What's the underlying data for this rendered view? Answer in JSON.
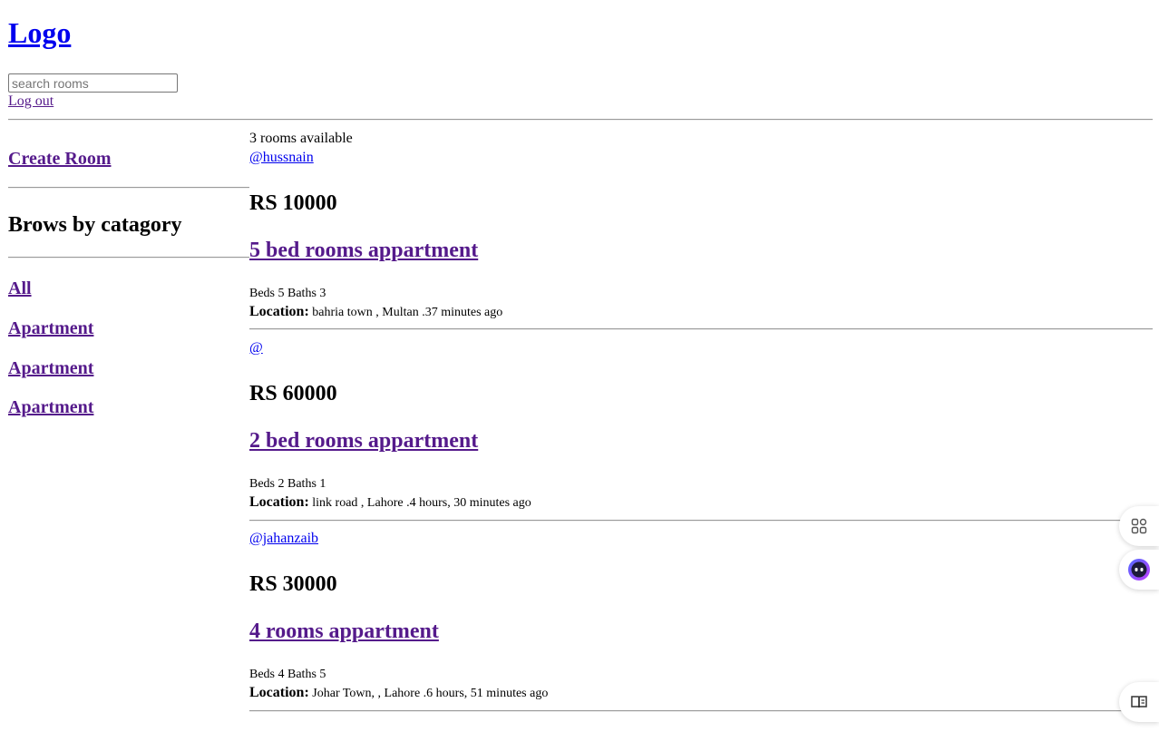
{
  "header": {
    "logo": "Logo",
    "search_placeholder": "search rooms",
    "logout": "Log out"
  },
  "sidebar": {
    "create_room": "Create Room",
    "browse_title": "Brows by catagory",
    "categories": [
      "All",
      "Apartment",
      "Apartment",
      "Apartment"
    ]
  },
  "main": {
    "count_text": "3 rooms available",
    "rooms": [
      {
        "user": "@hussnain",
        "price": "RS 10000",
        "title": "5 bed rooms appartment",
        "specs": "Beds 5 Baths 3",
        "location_label": "Location:",
        "location": "bahria town , Multan .37 minutes ago"
      },
      {
        "user": "@",
        "price": "RS 60000",
        "title": "2 bed rooms appartment",
        "specs": "Beds 2 Baths 1",
        "location_label": "Location:",
        "location": "link road , Lahore .4 hours, 30 minutes ago"
      },
      {
        "user": "@jahanzaib",
        "price": "RS 30000",
        "title": "4 rooms appartment",
        "specs": "Beds 4 Baths 5",
        "location_label": "Location:",
        "location": "Johar Town, , Lahore .6 hours, 51 minutes ago"
      }
    ]
  },
  "floating_widgets": {
    "icons": [
      "apps-icon",
      "assistant-face-icon",
      "reader-book-icon"
    ]
  },
  "colors": {
    "link_unvisited": "#0000ee",
    "link_visited": "#551a8b",
    "divider": "#9a9a9a"
  }
}
